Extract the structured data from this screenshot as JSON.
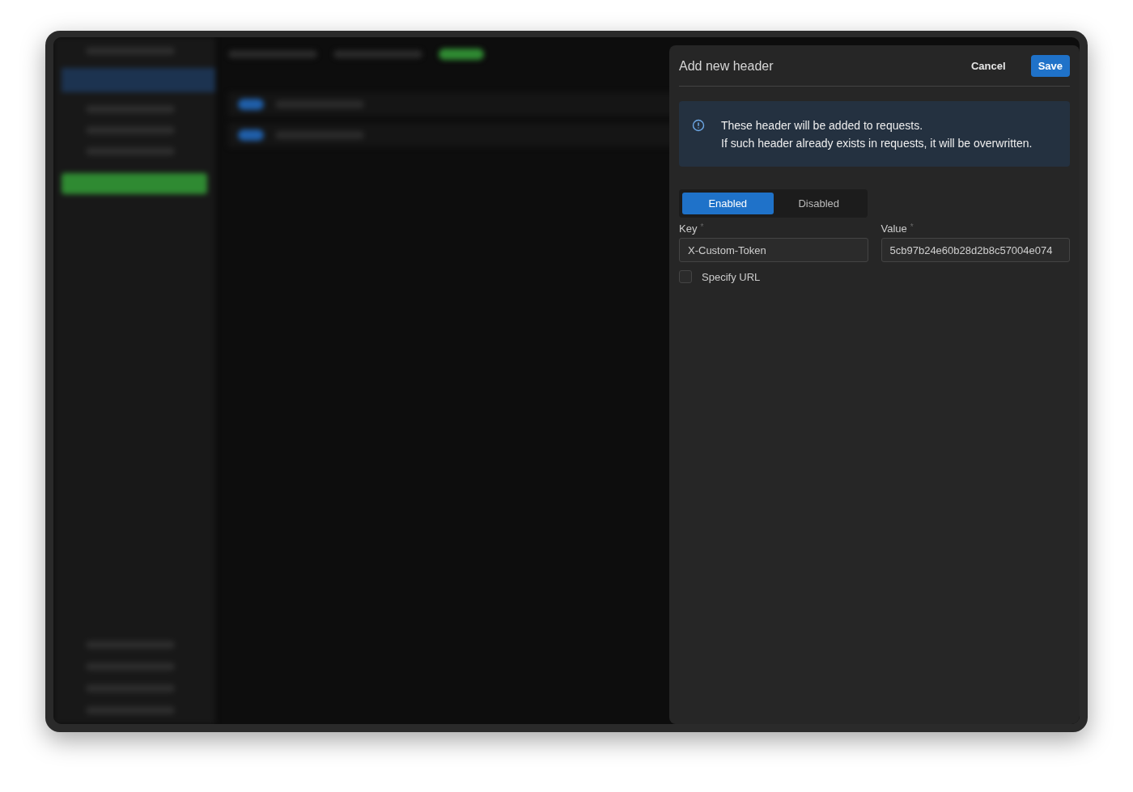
{
  "dialog": {
    "title": "Add new header",
    "buttons": [
      {
        "label": "Cancel",
        "kind": "text"
      },
      {
        "label": "Save",
        "kind": "primary"
      }
    ],
    "info": [
      "These header will be added to requests.",
      "If such header already exists in requests, it will be overwritten."
    ],
    "status_options": [
      {
        "label": "Enabled",
        "selected": true
      },
      {
        "label": "Disabled",
        "selected": false
      }
    ],
    "fields": [
      {
        "label": "Key",
        "mark": "*",
        "value": "X-Custom-Token"
      },
      {
        "label": "Value",
        "mark": "*",
        "value": "5cb97b24e60b28d2b8c57004e074"
      }
    ],
    "specify_url": {
      "label": "Specify URL",
      "checked": false
    }
  }
}
